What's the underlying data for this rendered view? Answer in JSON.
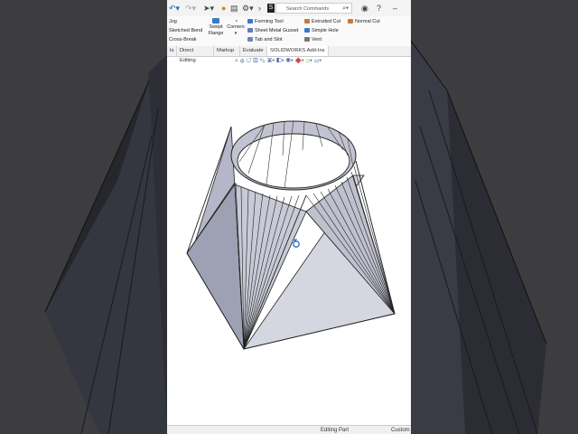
{
  "toolbar": {
    "search_placeholder": "Search Commands",
    "icons": [
      "undo-icon",
      "redo-icon",
      "select-icon",
      "rebuild-icon",
      "options-icon",
      "solidworks-icon",
      "search-icon",
      "user-icon",
      "help-icon",
      "minimize-icon"
    ]
  },
  "ribbon": {
    "col1": [
      "Jog",
      "Sketched Bend",
      "Cross-Break"
    ],
    "swept_flange": "Swept Flange",
    "corners": "Corners",
    "col3": [
      "Forming Tool",
      "Sheet Metal Gusset",
      "Tab and Slot"
    ],
    "col4": [
      "Extruded Cut",
      "Simple Hole",
      "Vent"
    ],
    "normal_cut": "Normal Cut"
  },
  "tabs": [
    "ts",
    "Direct Editing",
    "Markup",
    "Evaluate",
    "SOLIDWORKS Add-Ins"
  ],
  "status": {
    "editing": "Editing Part",
    "custom": "Custom"
  },
  "colors": {
    "face_light": "#c9cbd8",
    "face_mid": "#a8abbd",
    "face_dark": "#7d8094",
    "edge": "#222222",
    "background": "#ffffff"
  }
}
